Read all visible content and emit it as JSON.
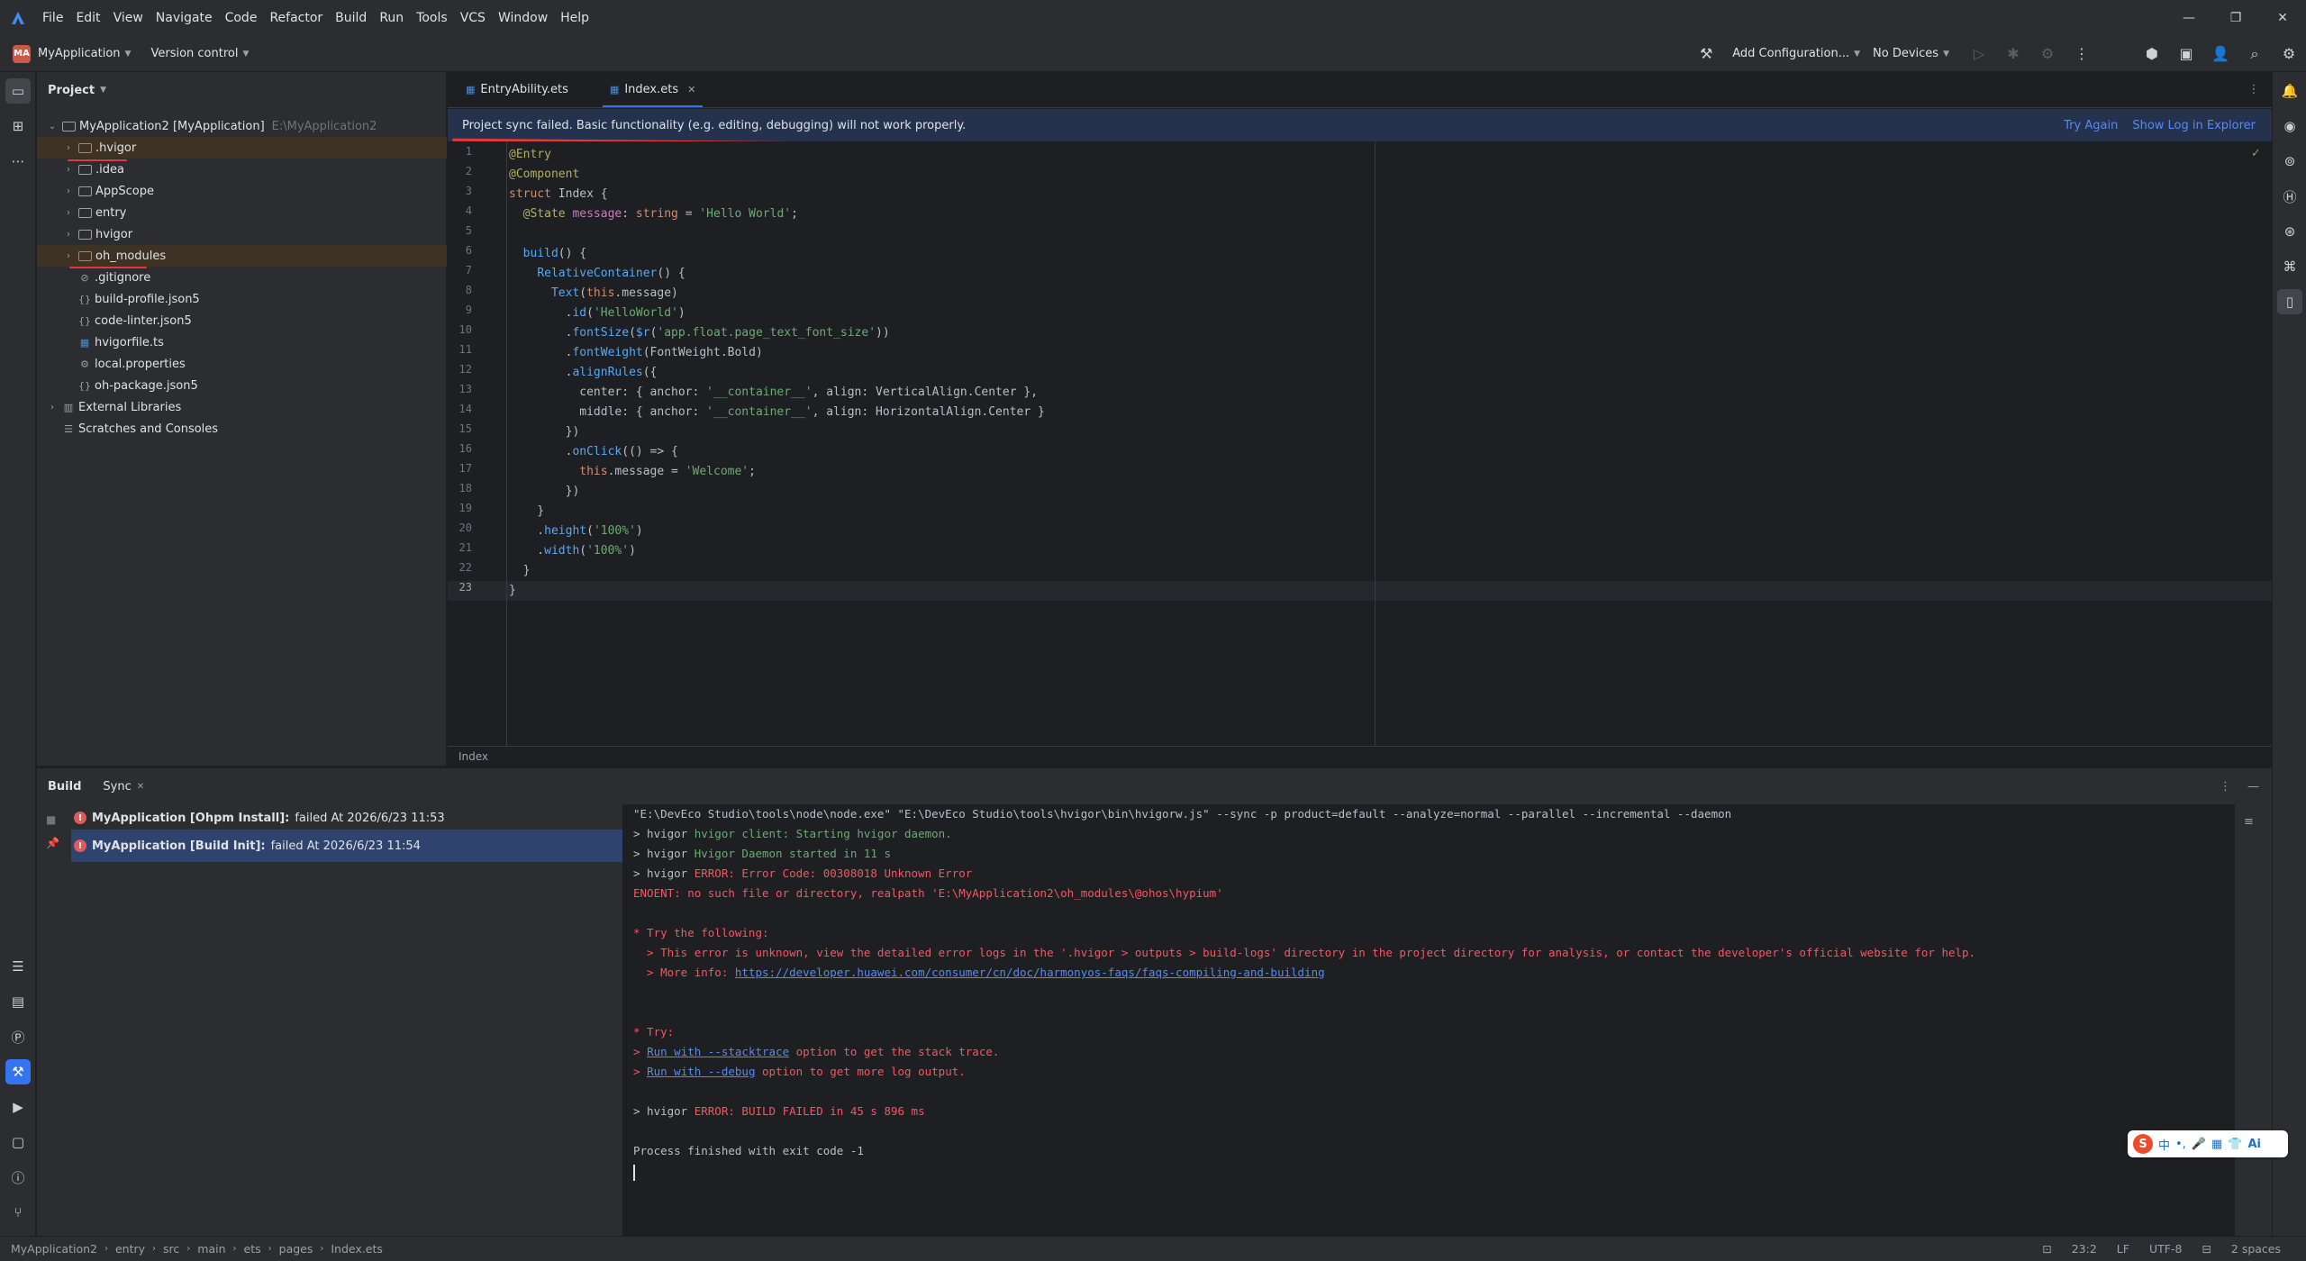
{
  "menu": [
    "File",
    "Edit",
    "View",
    "Navigate",
    "Code",
    "Refactor",
    "Build",
    "Run",
    "Tools",
    "VCS",
    "Window",
    "Help"
  ],
  "toolbar": {
    "project_badge": "MA",
    "project_name": "MyApplication",
    "vcs_label": "Version control",
    "run_config": "Add Configuration...",
    "device": "No Devices"
  },
  "project_panel": {
    "title": "Project",
    "root_name": "MyApplication2 [MyApplication]",
    "root_path": "E:\\MyApplication2",
    "items": [
      {
        "name": ".hvigor",
        "type": "folder-orange"
      },
      {
        "name": ".idea",
        "type": "folder"
      },
      {
        "name": "AppScope",
        "type": "folder"
      },
      {
        "name": "entry",
        "type": "folder"
      },
      {
        "name": "hvigor",
        "type": "folder"
      },
      {
        "name": "oh_modules",
        "type": "folder-orange"
      },
      {
        "name": ".gitignore",
        "type": "file"
      },
      {
        "name": "build-profile.json5",
        "type": "json"
      },
      {
        "name": "code-linter.json5",
        "type": "json"
      },
      {
        "name": "hvigorfile.ts",
        "type": "ts"
      },
      {
        "name": "local.properties",
        "type": "props"
      },
      {
        "name": "oh-package.json5",
        "type": "json"
      }
    ],
    "external_libraries": "External Libraries",
    "scratches": "Scratches and Consoles"
  },
  "editor": {
    "tabs": [
      {
        "label": "EntryAbility.ets"
      },
      {
        "label": "Index.ets"
      }
    ],
    "banner_text": "Project sync failed. Basic functionality (e.g. editing, debugging) will not work properly.",
    "banner_try_again": "Try Again",
    "banner_show_log": "Show Log in Explorer",
    "breadcrumb": "Index",
    "code_lines": [
      "@Entry",
      "@Component",
      "struct Index {",
      "  @State message: string = 'Hello World';",
      "",
      "  build() {",
      "    RelativeContainer() {",
      "      Text(this.message)",
      "        .id('HelloWorld')",
      "        .fontSize($r('app.float.page_text_font_size'))",
      "        .fontWeight(FontWeight.Bold)",
      "        .alignRules({",
      "          center: { anchor: '__container__', align: VerticalAlign.Center },",
      "          middle: { anchor: '__container__', align: HorizontalAlign.Center }",
      "        })",
      "        .onClick(() => {",
      "          this.message = 'Welcome';",
      "        })",
      "    }",
      "    .height('100%')",
      "    .width('100%')",
      "  }",
      "}"
    ]
  },
  "build_panel": {
    "tab_build": "Build",
    "tab_sync": "Sync",
    "tree": [
      {
        "title": "MyApplication [Ohpm Install]:",
        "status": "failed At 2026/6/23 11:53"
      },
      {
        "title": "MyApplication [Build Init]:",
        "status": "failed At 2026/6/23 11:54"
      }
    ],
    "console": {
      "cmd": "\"E:\\DevEco Studio\\tools\\node\\node.exe\" \"E:\\DevEco Studio\\tools\\hvigor\\bin\\hvigorw.js\" --sync -p product=default --analyze=normal --parallel --incremental --daemon",
      "l2_prefix": "> hvigor ",
      "l2_msg": "hvigor client: Starting hvigor daemon.",
      "l3_prefix": "> hvigor ",
      "l3_msg": "Hvigor Daemon started in 11 s",
      "l4_prefix": "> hvigor ",
      "l4_msg": "ERROR: Error Code: 00308018 Unknown Error",
      "l5": "ENOENT: no such file or directory, realpath 'E:\\MyApplication2\\oh_modules\\@ohos\\hypium'",
      "l6": "* Try the following:",
      "l7": "  > This error is unknown, view the detailed error logs in the '.hvigor > outputs > build-logs' directory in the project directory for analysis, or contact the developer's official website for help.",
      "l8_prefix": "  > More info: ",
      "l8_link": "https://developer.huawei.com/consumer/cn/doc/harmonyos-faqs/faqs-compiling-and-building",
      "l9": "* Try:",
      "l10_prefix": "> ",
      "l10_link": "Run with --stacktrace",
      "l10_suffix": " option to get the stack trace.",
      "l11_prefix": "> ",
      "l11_link": "Run with --debug",
      "l11_suffix": " option to get more log output.",
      "l12_prefix": "> hvigor ",
      "l12_msg": "ERROR: BUILD FAILED in 45 s 896 ms",
      "l13": "Process finished with exit code -1"
    }
  },
  "statusbar": {
    "crumbs": [
      "MyApplication2",
      "entry",
      "src",
      "main",
      "ets",
      "pages",
      "Index.ets"
    ],
    "position": "23:2",
    "line_sep": "LF",
    "encoding": "UTF-8",
    "indent": "2 spaces"
  },
  "ime": {
    "logo": "S",
    "lang": "中",
    "punct": "•,",
    "mic": "🎤",
    "ai": "Ai"
  }
}
